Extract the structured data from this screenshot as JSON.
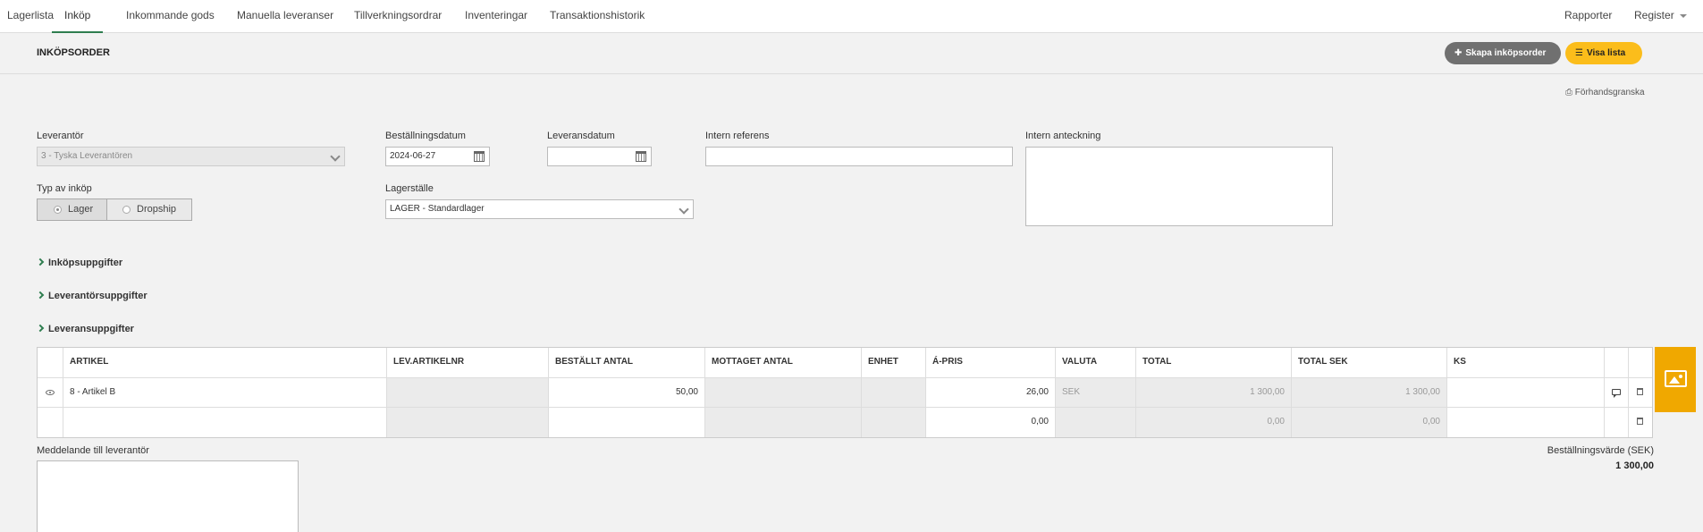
{
  "nav": {
    "tabs": [
      "Lagerlista",
      "Inköp",
      "Inkommande gods",
      "Manuella leveranser",
      "Tillverkningsordrar",
      "Inventeringar",
      "Transaktionshistorik"
    ],
    "active_tab": "Inköp",
    "right": {
      "reports": "Rapporter",
      "register": "Register"
    }
  },
  "header": {
    "title": "INKÖPSORDER",
    "create_button": "Skapa inköpsorder",
    "list_button": "Visa lista",
    "preview": "Förhandsgranska"
  },
  "form": {
    "supplier": {
      "label": "Leverantör",
      "value": "3 - Tyska Leverantören"
    },
    "order_date": {
      "label": "Beställningsdatum",
      "value": "2024-06-27"
    },
    "delivery_date": {
      "label": "Leveransdatum",
      "value": ""
    },
    "internal_ref": {
      "label": "Intern referens",
      "value": ""
    },
    "internal_note": {
      "label": "Intern anteckning",
      "value": ""
    },
    "purchase_type": {
      "label": "Typ av inköp",
      "options": [
        "Lager",
        "Dropship"
      ],
      "selected": "Lager"
    },
    "warehouse": {
      "label": "Lagerställe",
      "value": "LAGER - Standardlager"
    }
  },
  "sections": [
    "Inköpsuppgifter",
    "Leverantörsuppgifter",
    "Leveransuppgifter"
  ],
  "table": {
    "columns": [
      "ARTIKEL",
      "LEV.ARTIKELNR",
      "BESTÄLLT ANTAL",
      "MOTTAGET ANTAL",
      "ENHET",
      "Á-PRIS",
      "VALUTA",
      "TOTAL",
      "TOTAL SEK",
      "KS"
    ],
    "rows": [
      {
        "article": "8 - Artikel B",
        "supplier_art": "",
        "ordered": "50,00",
        "received": "",
        "unit": "",
        "price": "26,00",
        "currency": "SEK",
        "total": "1 300,00",
        "total_sek": "1 300,00",
        "ks": ""
      },
      {
        "article": "",
        "supplier_art": "",
        "ordered": "",
        "received": "",
        "unit": "",
        "price": "0,00",
        "currency": "",
        "total": "0,00",
        "total_sek": "0,00",
        "ks": ""
      }
    ]
  },
  "footer": {
    "message_label": "Meddelande till leverantör",
    "order_value_label": "Beställningsvärde (SEK)",
    "order_value": "1 300,00"
  },
  "colors": {
    "accent_green": "#2e7d4f",
    "yellow": "#fbbd1b",
    "grey_button": "#707070",
    "image_tab": "#f0a800"
  }
}
